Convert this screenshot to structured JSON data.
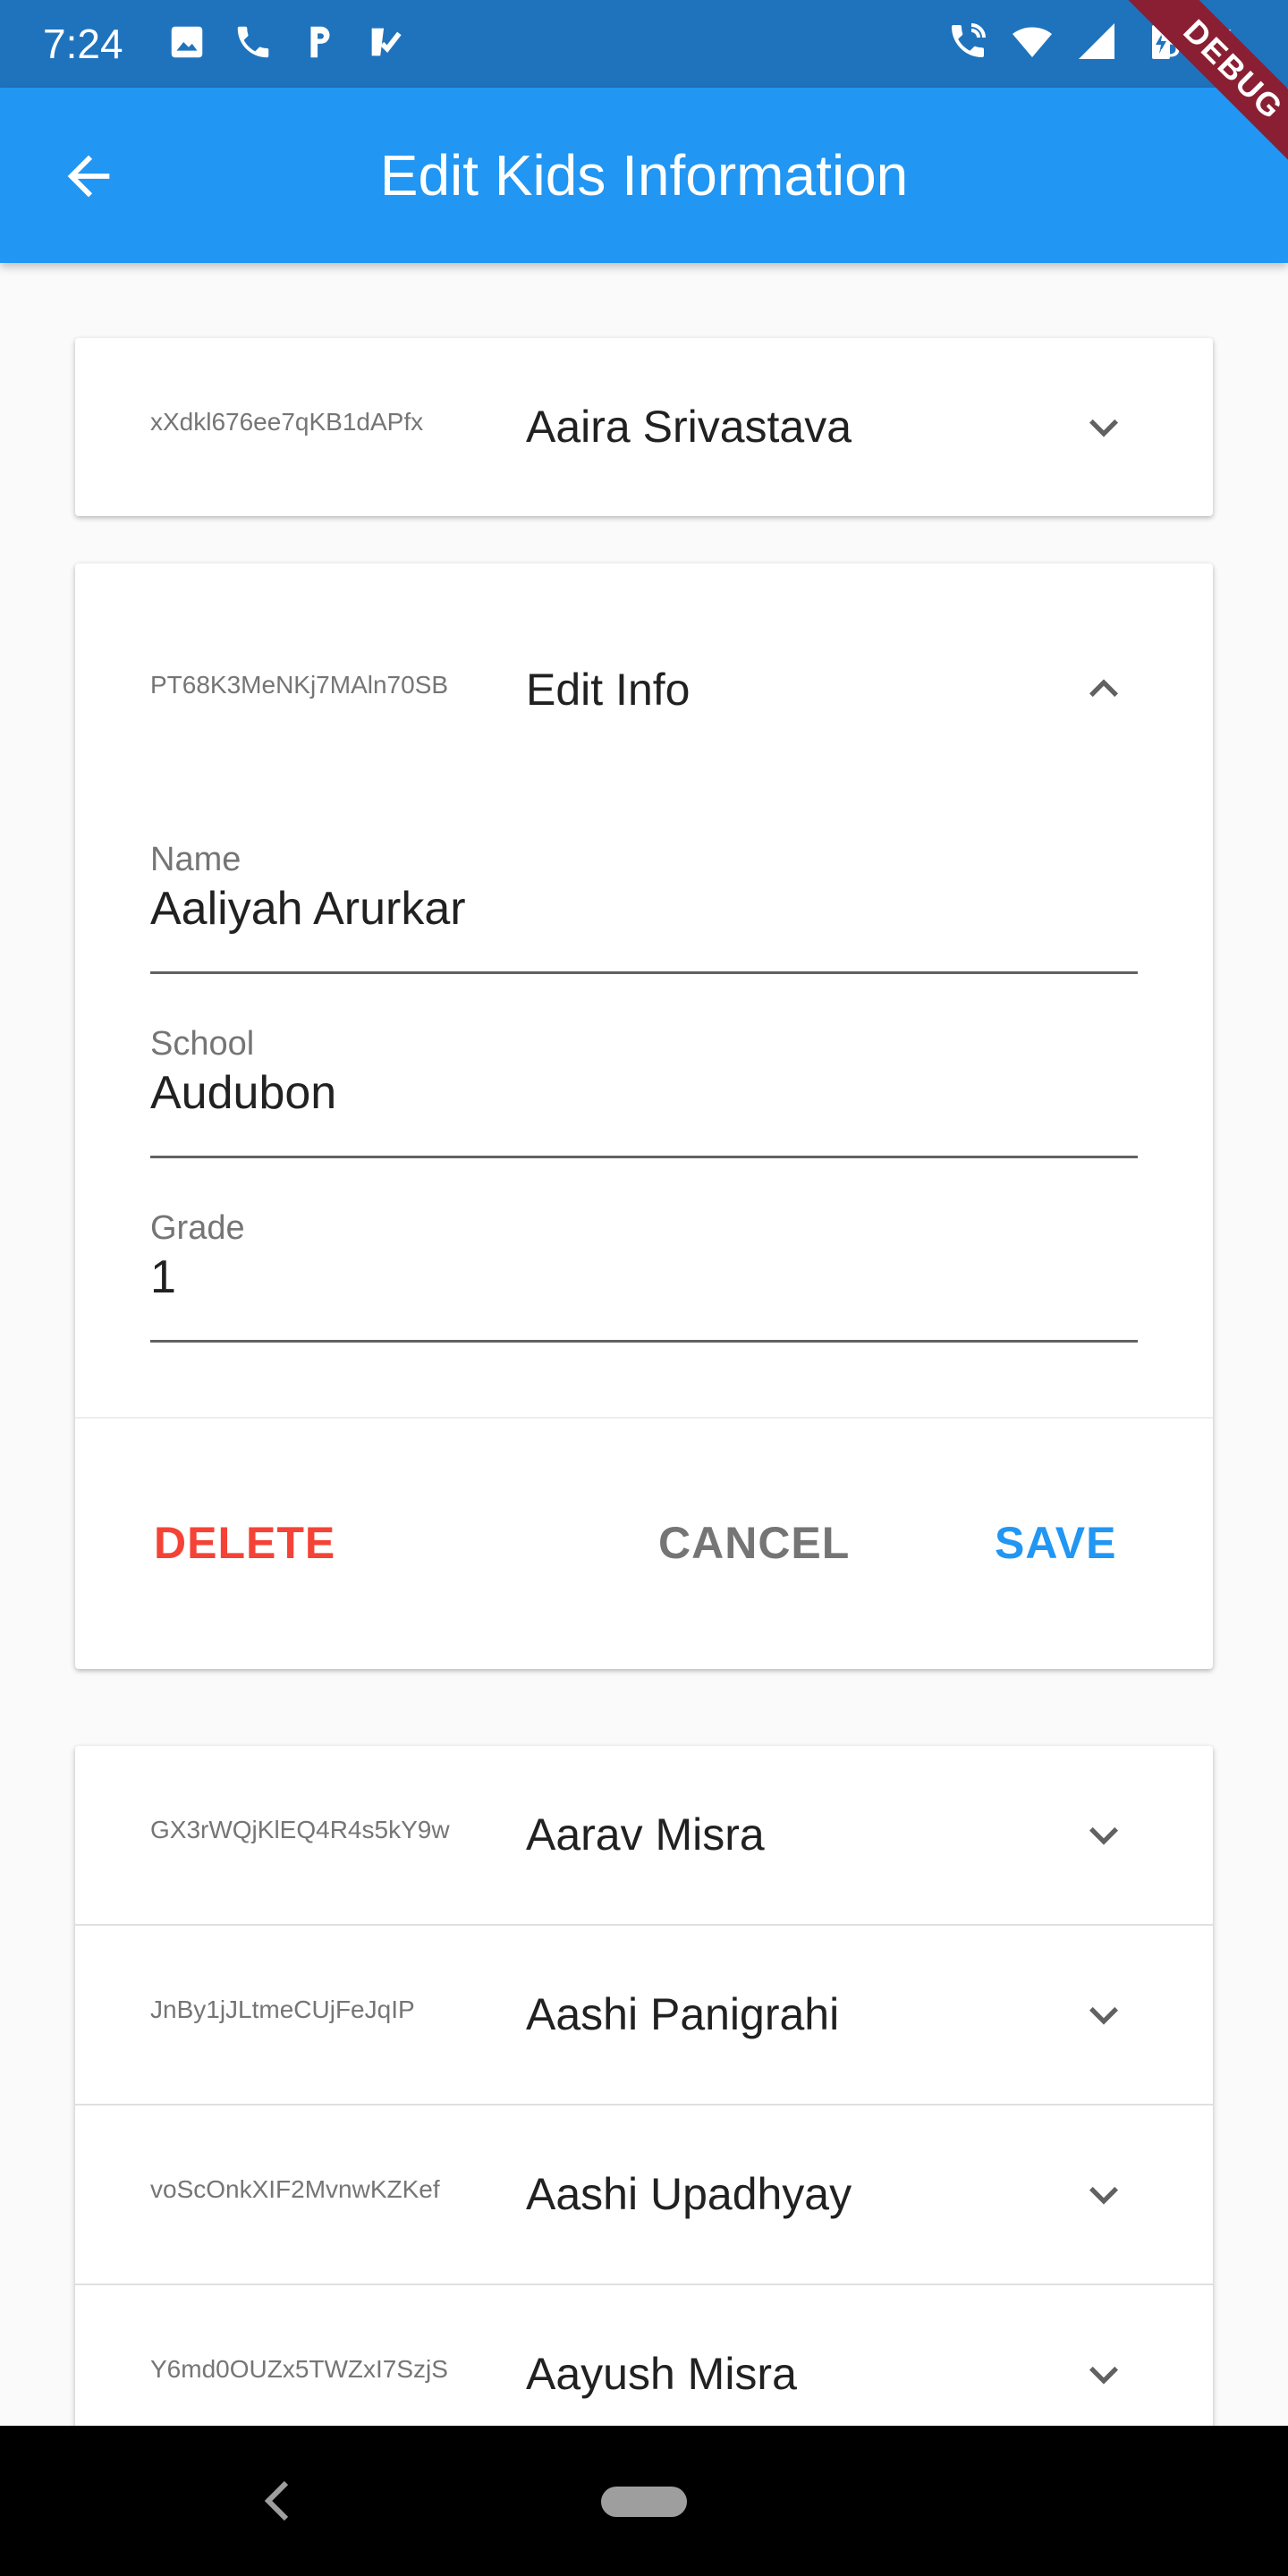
{
  "status_bar": {
    "time": "7:24",
    "battery": "35%",
    "left_icons": [
      "image-icon",
      "phone-icon",
      "parking-icon",
      "task-check-icon"
    ],
    "right_icons": [
      "wifi-calling-icon",
      "wifi-icon",
      "signal-icon",
      "battery-charging-icon"
    ]
  },
  "app_bar": {
    "title": "Edit Kids Information",
    "back_icon": "arrow-back-icon",
    "debug_banner": "DEBUG",
    "color": "#2196f3"
  },
  "cards": [
    {
      "items": [
        {
          "id": "xXdkl676ee7qKB1dAPfx",
          "name": "Aaira Srivastava",
          "expanded": false
        }
      ]
    },
    {
      "header": {
        "id": "PT68K3MeNKj7MAln70SB",
        "title": "Edit Info",
        "expanded": true
      },
      "fields": [
        {
          "label": "Name",
          "value": "Aaliyah Arurkar"
        },
        {
          "label": "School",
          "value": "Audubon"
        },
        {
          "label": "Grade",
          "value": "1"
        }
      ],
      "actions": {
        "delete": "DELETE",
        "cancel": "CANCEL",
        "save": "SAVE"
      }
    },
    {
      "items": [
        {
          "id": "GX3rWQjKlEQ4R4s5kY9w",
          "name": "Aarav Misra",
          "expanded": false
        },
        {
          "id": "JnBy1jJLtmeCUjFeJqIP",
          "name": "Aashi Panigrahi",
          "expanded": false
        },
        {
          "id": "voScOnkXIF2MvnwKZKef",
          "name": "Aashi Upadhyay",
          "expanded": false
        },
        {
          "id": "Y6md0OUZx5TWZxI7SzjS",
          "name": "Aayush Misra",
          "expanded": false
        }
      ]
    }
  ],
  "colors": {
    "delete": "#f44336",
    "save": "#2196f3",
    "cancel": "#757575"
  }
}
